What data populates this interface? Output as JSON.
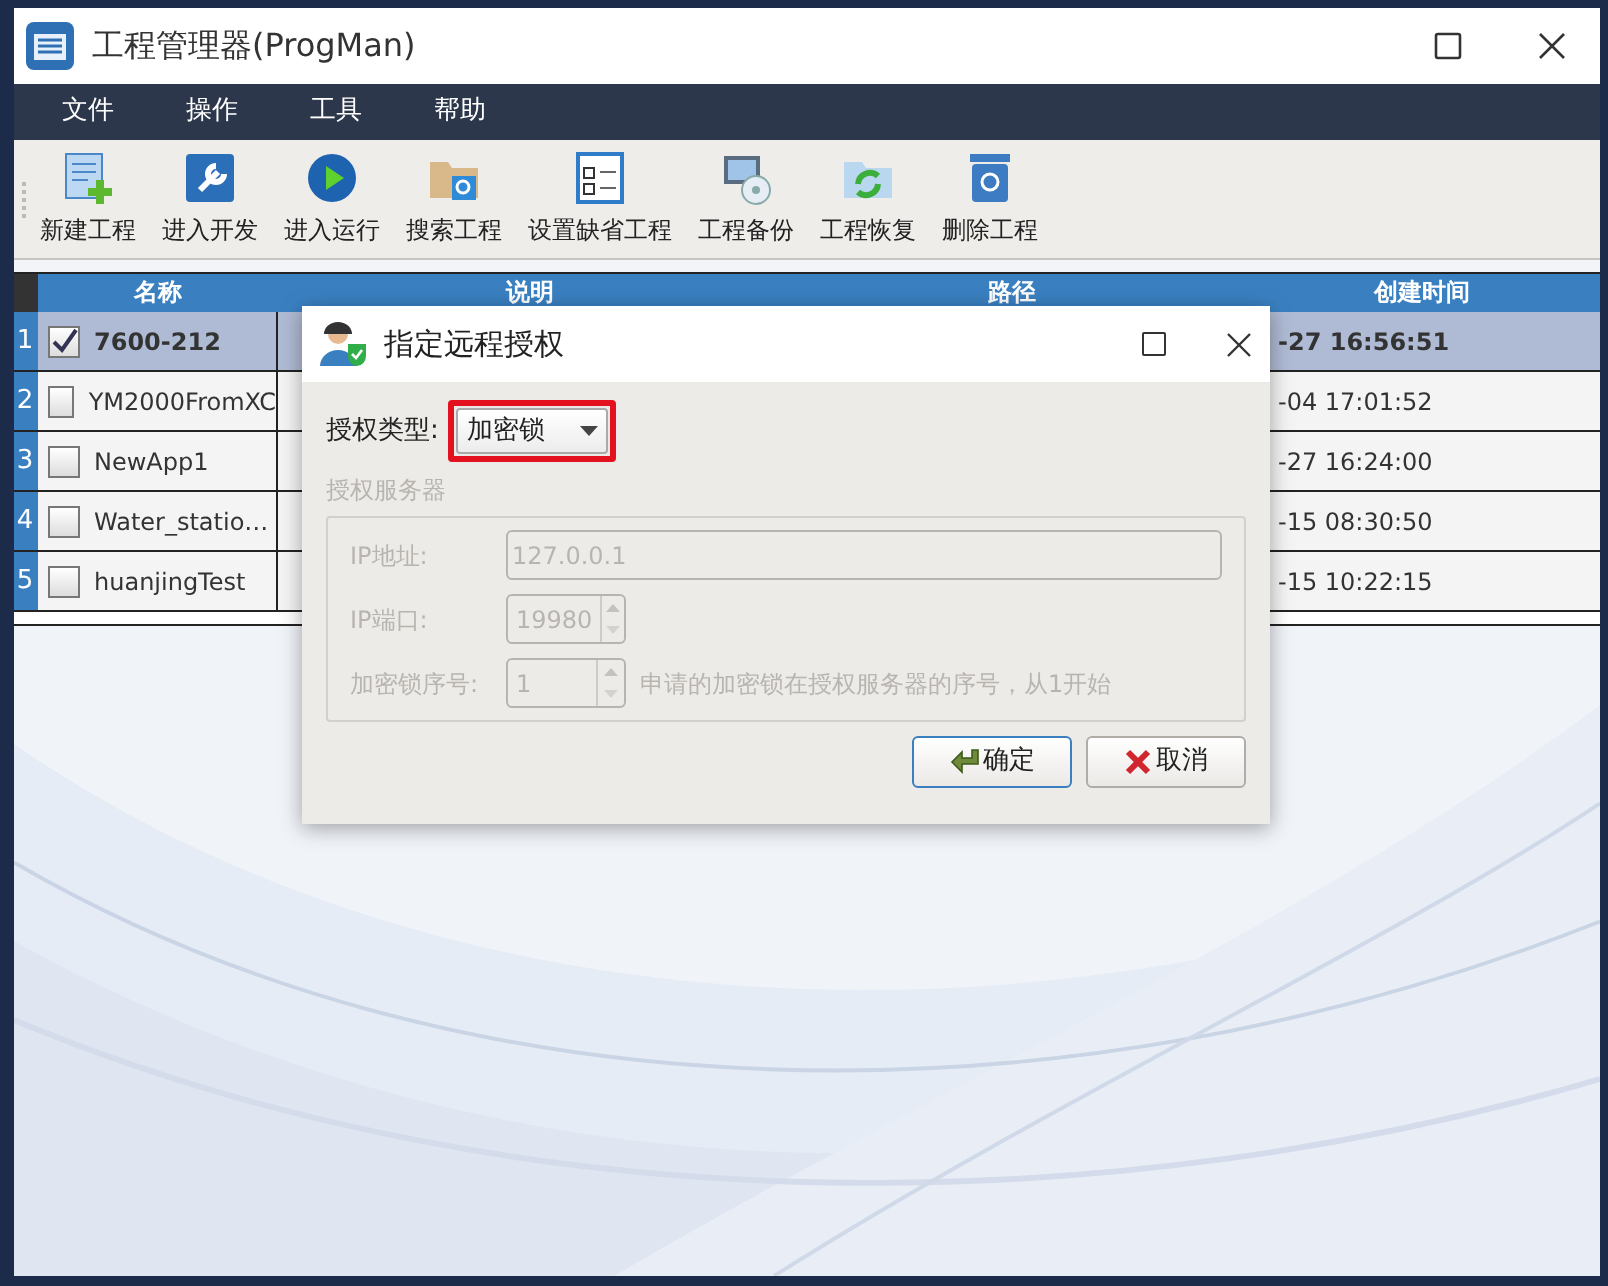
{
  "window": {
    "title": "工程管理器(ProgMan)"
  },
  "menu": [
    "文件",
    "操作",
    "工具",
    "帮助"
  ],
  "toolbar": [
    {
      "label": "新建工程"
    },
    {
      "label": "进入开发"
    },
    {
      "label": "进入运行"
    },
    {
      "label": "搜索工程"
    },
    {
      "label": "设置缺省工程"
    },
    {
      "label": "工程备份"
    },
    {
      "label": "工程恢复"
    },
    {
      "label": "删除工程"
    }
  ],
  "table": {
    "columns": [
      "名称",
      "说明",
      "路径",
      "创建时间"
    ],
    "rows": [
      {
        "number": "1",
        "name": "7600-212",
        "created": "-27 16:56:51",
        "checked": true,
        "selected": true
      },
      {
        "number": "2",
        "name": "YM2000FromXC",
        "created": "-04 17:01:52",
        "checked": false,
        "selected": false
      },
      {
        "number": "3",
        "name": "NewApp1",
        "created": "-27 16:24:00",
        "checked": false,
        "selected": false
      },
      {
        "number": "4",
        "name": "Water_statio…",
        "created": "-15 08:30:50",
        "checked": false,
        "selected": false
      },
      {
        "number": "5",
        "name": "huanjingTest",
        "created": "-15 10:22:15",
        "checked": false,
        "selected": false
      }
    ]
  },
  "dialog": {
    "title": "指定远程授权",
    "auth_type_label": "授权类型:",
    "auth_type_value": "加密锁",
    "auth_type_highlighted": true,
    "group": {
      "title": "授权服务器",
      "disabled": true,
      "fields": [
        {
          "kind": "text",
          "label": "IP地址:",
          "value": "127.0.0.1"
        },
        {
          "kind": "spin",
          "label": "IP端口:",
          "value": "19980"
        },
        {
          "kind": "spin",
          "label": "加密锁序号:",
          "value": "1",
          "hint": "申请的加密锁在授权服务器的序号，从1开始"
        }
      ]
    },
    "buttons": [
      {
        "kind": "ok",
        "label": "确定"
      },
      {
        "kind": "cancel",
        "label": "取消"
      }
    ]
  }
}
